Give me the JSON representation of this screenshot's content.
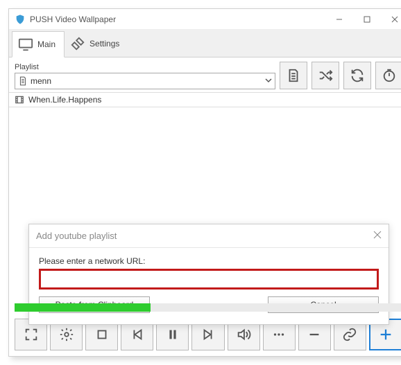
{
  "titlebar": {
    "title": "PUSH Video Wallpaper"
  },
  "tabs": {
    "main": "Main",
    "settings": "Settings"
  },
  "playlist": {
    "label": "Playlist",
    "selected": "menn"
  },
  "list": {
    "item0": "When.Life.Happens"
  },
  "dialog": {
    "title": "Add youtube playlist",
    "prompt": "Please enter a network URL:",
    "url_value": "",
    "paste_label": "Paste from Clipboard",
    "cancel_label": "Cancel"
  },
  "progress": {
    "percent": 35
  }
}
